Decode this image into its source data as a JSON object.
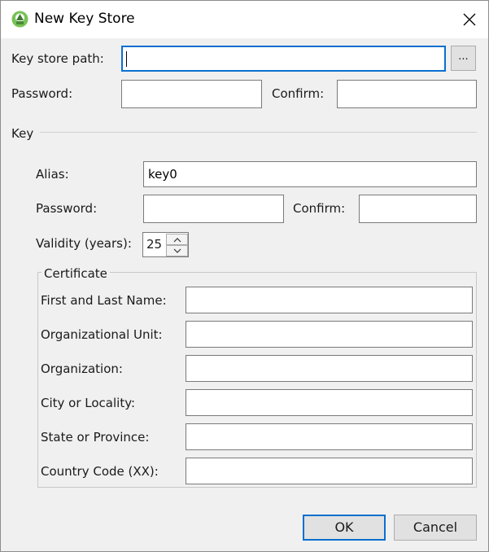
{
  "window": {
    "title": "New Key Store",
    "icon": "android-studio-icon",
    "close_icon": "close-icon"
  },
  "keystore": {
    "path_label": "Key store path:",
    "path_value": "",
    "browse_label": "...",
    "password_label": "Password:",
    "password_value": "",
    "confirm_label": "Confirm:",
    "confirm_value": ""
  },
  "key": {
    "section_label": "Key",
    "alias_label": "Alias:",
    "alias_value": "key0",
    "password_label": "Password:",
    "password_value": "",
    "confirm_label": "Confirm:",
    "confirm_value": "",
    "validity_label": "Validity (years):",
    "validity_value": "25"
  },
  "certificate": {
    "group_label": "Certificate",
    "fields": [
      {
        "label": "First and Last Name:",
        "value": ""
      },
      {
        "label": "Organizational Unit:",
        "value": ""
      },
      {
        "label": "Organization:",
        "value": ""
      },
      {
        "label": "City or Locality:",
        "value": ""
      },
      {
        "label": "State or Province:",
        "value": ""
      },
      {
        "label": "Country Code (XX):",
        "value": ""
      }
    ]
  },
  "buttons": {
    "ok": "OK",
    "cancel": "Cancel"
  },
  "colors": {
    "accent": "#0a6fd0",
    "dialog_bg": "#f0f0f0",
    "android_green": "#78c257"
  }
}
